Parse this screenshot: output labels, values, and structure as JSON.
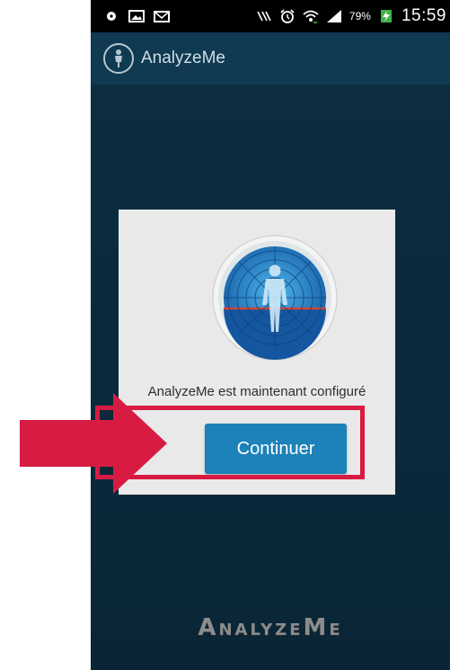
{
  "status_bar": {
    "left_icons": [
      "notification-dot-icon",
      "image-icon",
      "email-icon"
    ],
    "right_icons": [
      "nfc-icon",
      "alarm-icon",
      "wifi-icon",
      "signal-icon",
      "battery-charging-icon"
    ],
    "battery_percent": "79%",
    "time": "15:59"
  },
  "action_bar": {
    "title": "AnalyzeMe"
  },
  "dialog": {
    "message": "AnalyzeMe est maintenant configuré",
    "continue_label": "Continuer"
  },
  "brand": {
    "logo_text": "AnalyzeMe"
  },
  "colors": {
    "accent_button": "#1c82b8",
    "highlight": "#d81b43",
    "background": "#0b2b3d",
    "action_bar": "#0f3a51"
  }
}
